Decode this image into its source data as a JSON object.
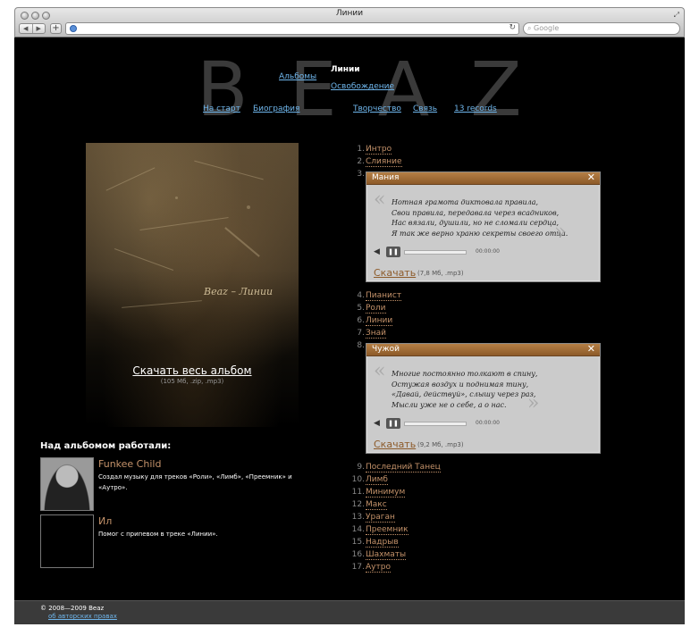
{
  "browser": {
    "window_title": "Линии",
    "search_placeholder": "Google"
  },
  "logo": "BEAZ",
  "nav": {
    "albums": "Альбомы",
    "current_title": "Линии",
    "release": "Освобождение",
    "home": "На старт",
    "biography": "Биография",
    "creativity": "Творчество",
    "contact": "Связь",
    "label": "13 records"
  },
  "album": {
    "cover_signature": "Beaz – Линии",
    "download_label": "Скачать весь альбом",
    "download_note": "(105 Мб, .zip, .mp3)"
  },
  "credits": {
    "title": "Над альбомом работали:",
    "contributors": [
      {
        "name": "Funkee Child",
        "desc": "Создал музыку для треков «Роли», «Лимб», «Преемник» и «Аутро»."
      },
      {
        "name": "Ил",
        "desc": "Помог с припевом в треке «Линии»."
      }
    ]
  },
  "tracks": [
    {
      "num": "1.",
      "name": "Интро"
    },
    {
      "num": "2.",
      "name": "Слияние"
    },
    {
      "num": "3.",
      "name": ""
    },
    {
      "num": "4.",
      "name": "Пианист"
    },
    {
      "num": "5.",
      "name": "Роли"
    },
    {
      "num": "6.",
      "name": "Линии"
    },
    {
      "num": "7.",
      "name": "Знай"
    },
    {
      "num": "8.",
      "name": ""
    },
    {
      "num": "9.",
      "name": "Последний Танец"
    },
    {
      "num": "10.",
      "name": "Лимб"
    },
    {
      "num": "11.",
      "name": "Минимум"
    },
    {
      "num": "12.",
      "name": "Макс"
    },
    {
      "num": "13.",
      "name": "Ураган"
    },
    {
      "num": "14.",
      "name": "Преемник"
    },
    {
      "num": "15.",
      "name": "Надрыв"
    },
    {
      "num": "16.",
      "name": "Шахматы"
    },
    {
      "num": "17.",
      "name": "Аутро"
    }
  ],
  "players": [
    {
      "title": "Мания",
      "lyrics": [
        "Нотная грамота диктовала правила,",
        "Свои правила, передавала через всадников,",
        "Нас вязали, душили, но не сломали сердца,",
        "Я так же верно храню секреты своего отца."
      ],
      "time": "00:00:00",
      "download_label": "Скачать",
      "download_note": "(7,8 Мб, .mp3)"
    },
    {
      "title": "Чужой",
      "lyrics": [
        "Многие постоянно толкают в спину,",
        "Остужая воздух и поднимая тину,",
        "«Давай, действуй», слышу через раз,",
        "Мысли уже не о себе, а о нас."
      ],
      "time": "00:00:00",
      "download_label": "Скачать",
      "download_note": "(9,2 Мб, .mp3)"
    }
  ],
  "footer": {
    "copyright": "© 2008—2009 Beaz",
    "rights_link": "об авторских правах"
  },
  "colors": {
    "page_bg": "#000000",
    "link": "#6fb6ec",
    "track": "#c4926a",
    "player_bar": "#b57f45"
  }
}
